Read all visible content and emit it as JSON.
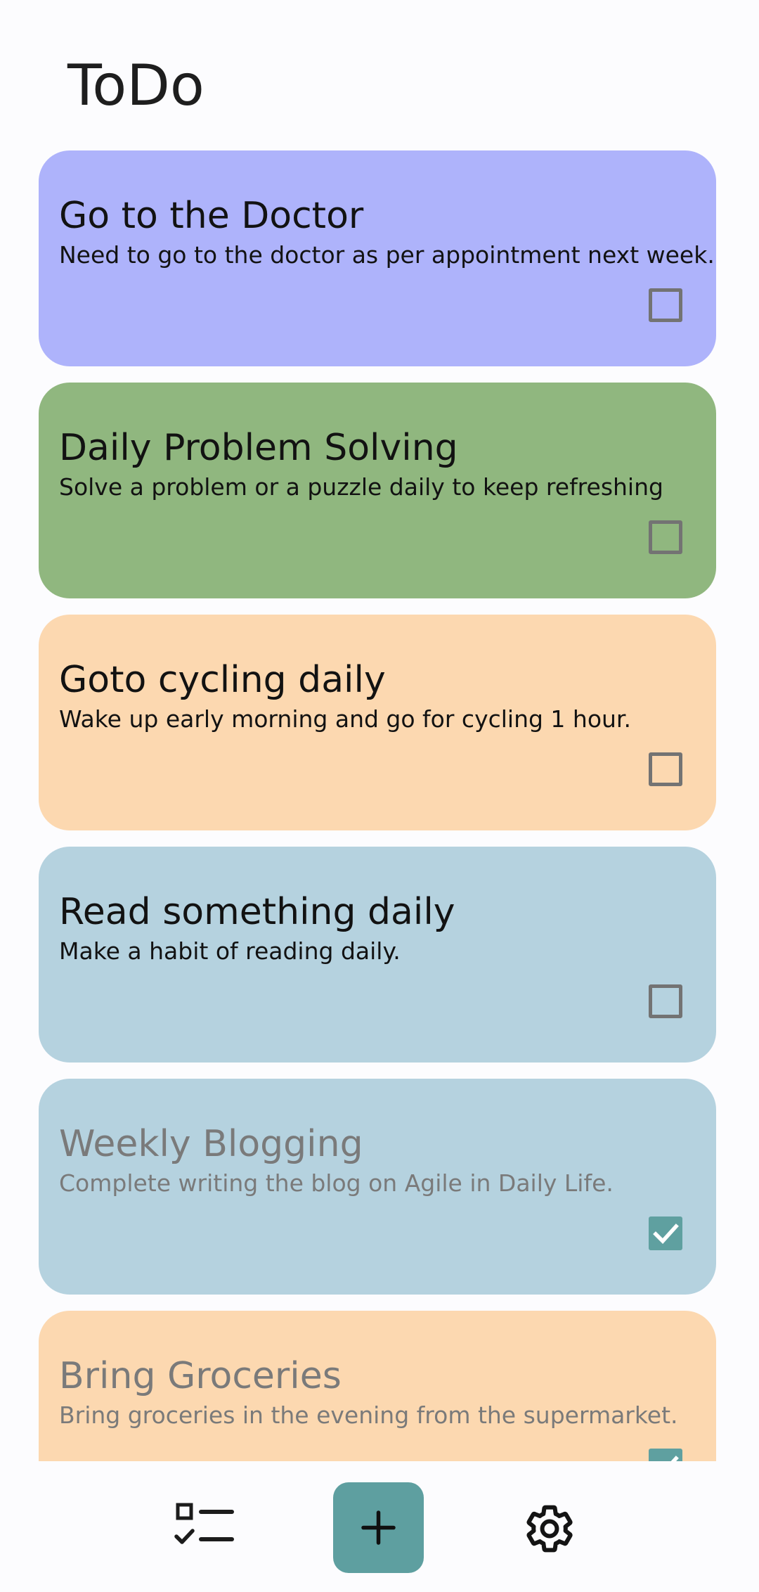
{
  "header": {
    "title": "ToDo"
  },
  "colors": {
    "lavender": "#aeb3fb",
    "green": "#90b77f",
    "peach": "#fcd8b0",
    "light_blue": "#b5d2df",
    "accent_teal": "#5e9fa0"
  },
  "tasks": [
    {
      "title": "Go to the Doctor",
      "description": "Need to go to the doctor as per appointment next week.",
      "color": "#aeb3fb",
      "completed": false
    },
    {
      "title": "Daily Problem Solving",
      "description": "Solve a problem or a puzzle daily to keep refreshing",
      "color": "#90b77f",
      "completed": false
    },
    {
      "title": "Goto cycling daily",
      "description": "Wake up early morning and go for cycling 1 hour.",
      "color": "#fcd8b0",
      "completed": false
    },
    {
      "title": "Read something daily",
      "description": "Make a habit of reading daily.",
      "color": "#b5d2df",
      "completed": false
    },
    {
      "title": "Weekly Blogging",
      "description": "Complete writing the blog on Agile in Daily Life.",
      "color": "#b5d2df",
      "completed": true
    },
    {
      "title": "Bring Groceries",
      "description": "Bring groceries in the evening from the supermarket.",
      "color": "#fcd8b0",
      "completed": true
    }
  ],
  "bottom_nav": {
    "items": [
      {
        "icon": "task-list-icon"
      },
      {
        "icon": "plus-icon"
      },
      {
        "icon": "gear-icon"
      }
    ]
  }
}
